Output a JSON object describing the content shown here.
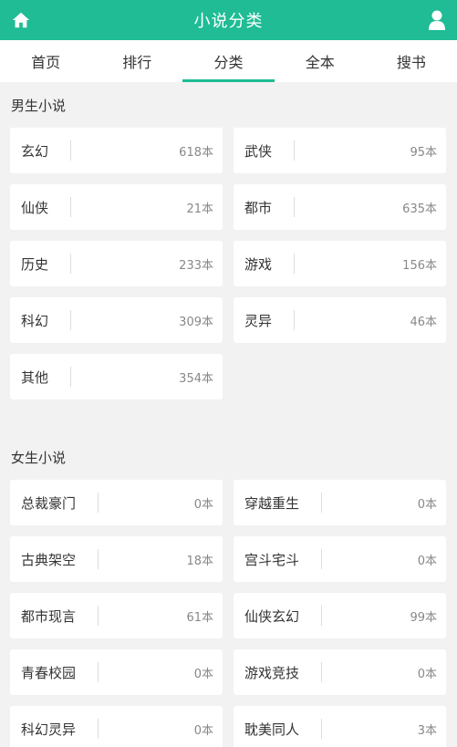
{
  "header": {
    "title": "小说分类",
    "home_icon": "home-icon",
    "user_icon": "user-icon",
    "bg_color": "#1fbc95"
  },
  "tabs": [
    {
      "label": "首页",
      "active": false
    },
    {
      "label": "排行",
      "active": false
    },
    {
      "label": "分类",
      "active": true
    },
    {
      "label": "全本",
      "active": false
    },
    {
      "label": "搜书",
      "active": false
    }
  ],
  "male": {
    "title": "男生小说",
    "items": [
      {
        "name": "玄幻",
        "count": "618本"
      },
      {
        "name": "武侠",
        "count": "95本"
      },
      {
        "name": "仙侠",
        "count": "21本"
      },
      {
        "name": "都市",
        "count": "635本"
      },
      {
        "name": "历史",
        "count": "233本"
      },
      {
        "name": "游戏",
        "count": "156本"
      },
      {
        "name": "科幻",
        "count": "309本"
      },
      {
        "name": "灵异",
        "count": "46本"
      },
      {
        "name": "其他",
        "count": "354本"
      }
    ]
  },
  "female": {
    "title": "女生小说",
    "items": [
      {
        "name": "总裁豪门",
        "count": "0本"
      },
      {
        "name": "穿越重生",
        "count": "0本"
      },
      {
        "name": "古典架空",
        "count": "18本"
      },
      {
        "name": "宫斗宅斗",
        "count": "0本"
      },
      {
        "name": "都市现言",
        "count": "61本"
      },
      {
        "name": "仙侠玄幻",
        "count": "99本"
      },
      {
        "name": "青春校园",
        "count": "0本"
      },
      {
        "name": "游戏竞技",
        "count": "0本"
      },
      {
        "name": "科幻灵异",
        "count": "0本"
      },
      {
        "name": "耽美同人",
        "count": "3本"
      }
    ]
  }
}
